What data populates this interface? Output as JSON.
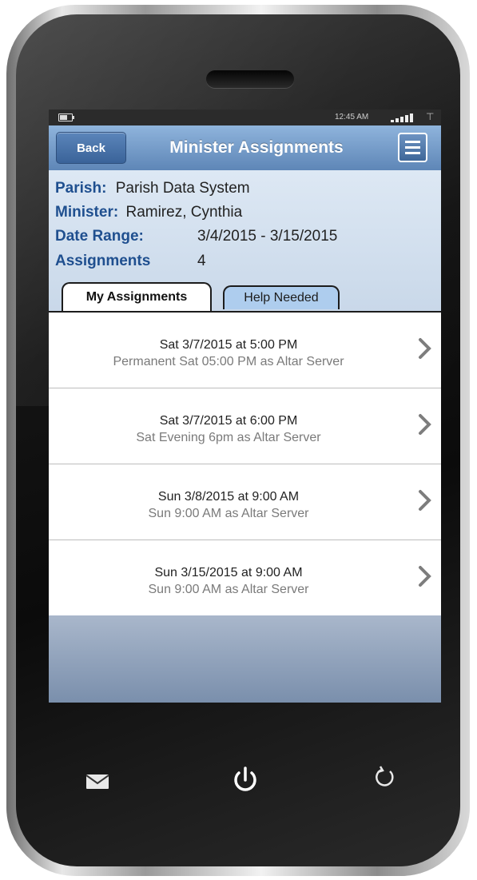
{
  "status_bar": {
    "time": "12:45 AM"
  },
  "nav": {
    "back_label": "Back",
    "title": "Minister Assignments"
  },
  "info": {
    "parish_label": "Parish:",
    "parish_value": "Parish Data System",
    "minister_label": "Minister:",
    "minister_value": "Ramirez, Cynthia",
    "date_range_label": "Date Range:",
    "date_range_value": "3/4/2015 - 3/15/2015",
    "assignments_label": "Assignments",
    "assignments_value": "4"
  },
  "tabs": [
    {
      "label": "My Assignments",
      "active": true
    },
    {
      "label": "Help Needed",
      "active": false
    }
  ],
  "assignments": [
    {
      "when": "Sat 3/7/2015 at 5:00 PM",
      "detail": "Permanent Sat 05:00 PM as Altar Server"
    },
    {
      "when": "Sat 3/7/2015 at 6:00 PM",
      "detail": "Sat Evening 6pm as Altar Server"
    },
    {
      "when": "Sun 3/8/2015 at 9:00 AM",
      "detail": "Sun 9:00 AM as Altar Server"
    },
    {
      "when": "Sun 3/15/2015 at 9:00 AM",
      "detail": "Sun 9:00 AM as Altar Server"
    }
  ],
  "icons": {
    "menu": "hamburger-menu-icon",
    "chevron": "chevron-right-icon",
    "mail": "mail-icon",
    "power": "power-icon",
    "refresh": "refresh-icon",
    "battery": "battery-icon",
    "signal": "signal-icon",
    "wifi": "wifi-icon"
  },
  "colors": {
    "nav_bar": "#5e86b7",
    "label_blue": "#1f4f8f",
    "inactive_tab": "#aecdee",
    "header_panel": "#dde8f4"
  }
}
